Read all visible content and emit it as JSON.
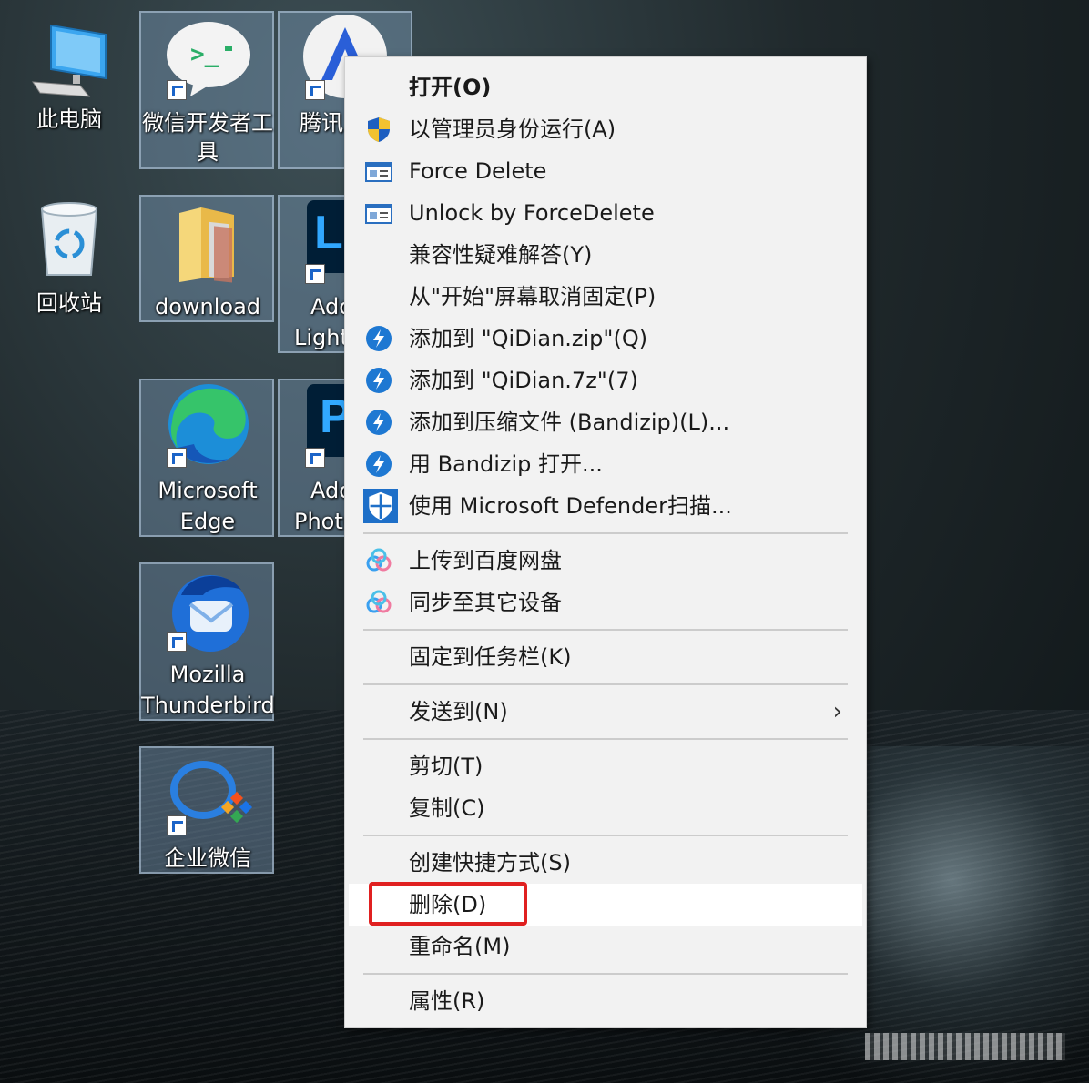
{
  "desktop": {
    "icons": {
      "this_pc": "此电脑",
      "recycle_bin": "回收站",
      "wechat_dev_line1": "微信开发者工",
      "wechat_dev_line2": "具",
      "tencent_partial": "腾讯",
      "download": "download",
      "adobe_lr_line1": "Ado",
      "adobe_lr_line2": "Light",
      "edge_line1": "Microsoft",
      "edge_line2": "Edge",
      "adobe_ps_line1": "Ado",
      "adobe_ps_line2": "Photo",
      "thunderbird_line1": "Mozilla",
      "thunderbird_line2": "Thunderbird",
      "wecom": "企业微信"
    }
  },
  "context_menu": {
    "items": {
      "open": "打开(O)",
      "run_as_admin": "以管理员身份运行(A)",
      "force_delete": "Force Delete",
      "unlock_force_delete": "Unlock by ForceDelete",
      "compat_troubleshoot": "兼容性疑难解答(Y)",
      "unpin_start": "从\"开始\"屏幕取消固定(P)",
      "add_zip": "添加到 \"QiDian.zip\"(Q)",
      "add_7z": "添加到 \"QiDian.7z\"(7)",
      "add_archive": "添加到压缩文件 (Bandizip)(L)...",
      "open_bandizip": "用 Bandizip 打开...",
      "defender_scan": "使用 Microsoft Defender扫描...",
      "upload_baidu": "上传到百度网盘",
      "sync_devices": "同步至其它设备",
      "pin_taskbar": "固定到任务栏(K)",
      "send_to": "发送到(N)",
      "cut": "剪切(T)",
      "copy": "复制(C)",
      "create_shortcut": "创建快捷方式(S)",
      "delete": "删除(D)",
      "rename": "重命名(M)",
      "properties": "属性(R)"
    },
    "submenu_arrow": "›"
  },
  "colors": {
    "highlight_border": "#e02020",
    "menu_bg": "#f2f2f2",
    "bandizip_blue": "#1e78d2"
  }
}
